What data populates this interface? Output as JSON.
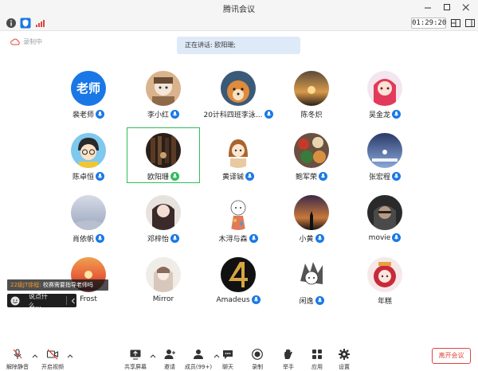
{
  "window": {
    "title": "腾讯会议"
  },
  "toolbar": {
    "timer": "01:29:20"
  },
  "recording": {
    "label": "录制中"
  },
  "speaking": {
    "text": "正在讲话: 欧阳珊;"
  },
  "participants": [
    {
      "name": "裴老师",
      "avatar_text": "老师",
      "mic": true
    },
    {
      "name": "李小红",
      "mic": true
    },
    {
      "name": "20计科四班李泳...",
      "mic": true
    },
    {
      "name": "陈冬炽",
      "mic": false
    },
    {
      "name": "吴金龙",
      "mic": true
    },
    {
      "name": "陈卓恒",
      "mic": true
    },
    {
      "name": "欧阳珊",
      "mic": true,
      "active": true
    },
    {
      "name": "黄译铖",
      "mic": true
    },
    {
      "name": "鲍军荣",
      "mic": true
    },
    {
      "name": "张宏程",
      "mic": true
    },
    {
      "name": "肖依帆",
      "mic": true
    },
    {
      "name": "邓梓怡",
      "mic": true
    },
    {
      "name": "木浔与森",
      "mic": true
    },
    {
      "name": "小黄",
      "mic": true
    },
    {
      "name": "movie",
      "mic": true
    },
    {
      "name": "Frost",
      "mic": false
    },
    {
      "name": "Mirror",
      "mic": false
    },
    {
      "name": "Amadeus",
      "mic": true
    },
    {
      "name": "闲逸",
      "mic": true
    },
    {
      "name": "年糕",
      "mic": false
    }
  ],
  "chat": {
    "sender": "22级JT徐程:",
    "message": "校赛需要指导老师吗",
    "placeholder": "说点什么..."
  },
  "bottombar": {
    "unmute": "解除静音",
    "video": "开启视频",
    "share": "共享屏幕",
    "invite": "邀请",
    "members": "成员(99+)",
    "chat": "聊天",
    "record": "录制",
    "raise_hand": "举手",
    "apps": "应用",
    "settings": "设置",
    "leave": "离开会议"
  },
  "colors": {
    "accent": "#1978e5",
    "active_border": "#2ebd59",
    "danger": "#e0453e"
  }
}
